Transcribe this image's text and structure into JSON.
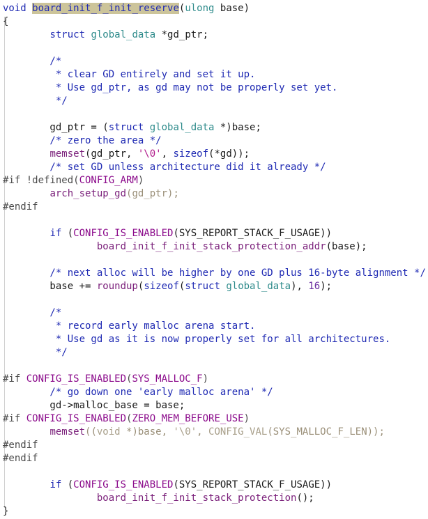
{
  "code": {
    "lines": [
      "void board_init_f_init_reserve(ulong base)",
      "{",
      "        struct global_data *gd_ptr;",
      "",
      "        /*",
      "         * clear GD entirely and set it up.",
      "         * Use gd_ptr, as gd may not be properly set yet.",
      "         */",
      "",
      "        gd_ptr = (struct global_data *)base;",
      "        /* zero the area */",
      "        memset(gd_ptr, '\\0', sizeof(*gd));",
      "        /* set GD unless architecture did it already */",
      "#if !defined(CONFIG_ARM)",
      "        arch_setup_gd(gd_ptr);",
      "#endif",
      "",
      "        if (CONFIG_IS_ENABLED(SYS_REPORT_STACK_F_USAGE))",
      "                board_init_f_init_stack_protection_addr(base);",
      "",
      "        /* next alloc will be higher by one GD plus 16-byte alignment */",
      "        base += roundup(sizeof(struct global_data), 16);",
      "",
      "        /*",
      "         * record early malloc arena start.",
      "         * Use gd as it is now properly set for all architectures.",
      "         */",
      "",
      "#if CONFIG_IS_ENABLED(SYS_MALLOC_F)",
      "        /* go down one 'early malloc arena' */",
      "        gd->malloc_base = base;",
      "#if CONFIG_IS_ENABLED(ZERO_MEM_BEFORE_USE)",
      "        memset((void *)base, '\\0', CONFIG_VAL(SYS_MALLOC_F_LEN));",
      "#endif",
      "#endif",
      "",
      "        if (CONFIG_IS_ENABLED(SYS_REPORT_STACK_F_USAGE))",
      "                board_init_f_init_stack_protection();",
      "}"
    ],
    "highlighted_symbol": "board_init_f_init_reserve",
    "colors": {
      "keyword": "#1f2ab3",
      "type": "#2e8b8b",
      "macro": "#8b0a8b",
      "comment": "#1f2ab3",
      "string": "#b0188a",
      "inactive": "#9a8f78",
      "highlight_bg": "#ccc49a"
    }
  }
}
